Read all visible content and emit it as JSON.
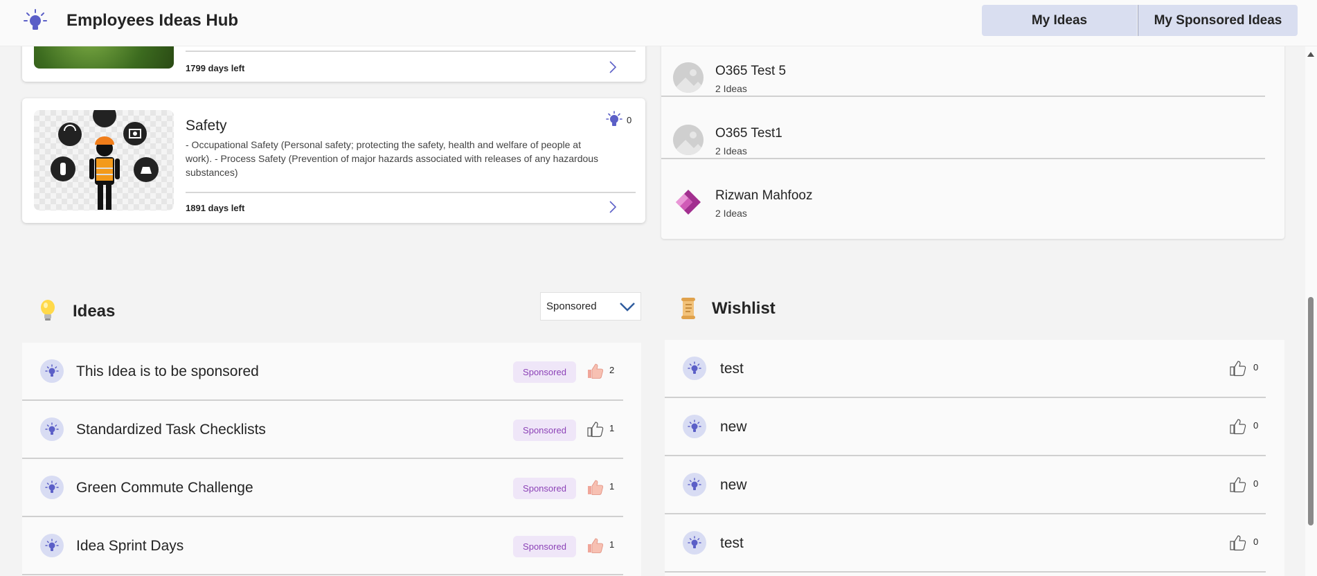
{
  "header": {
    "title": "Employees Ideas Hub",
    "nav": [
      "My Ideas",
      "My Sponsored Ideas"
    ]
  },
  "challenges": [
    {
      "days_left": "1799 days left"
    },
    {
      "title": "Safety",
      "description": "- Occupational Safety (Personal safety; protecting the safety, health and welfare of people at work). - Process Safety (Prevention of major hazards associated with releases of any hazardous substances)",
      "idea_count": "0",
      "days_left": "1891 days left"
    }
  ],
  "sponsors": [
    {
      "name": "O365 Test 5",
      "ideas": "2 Ideas",
      "avatar": "placeholder-image-icon"
    },
    {
      "name": "O365 Test1",
      "ideas": "2 Ideas",
      "avatar": "placeholder-image-icon"
    },
    {
      "name": "Rizwan Mahfooz",
      "ideas": "2 Ideas",
      "avatar": "power-apps-logo-icon"
    }
  ],
  "ideas_section": {
    "title": "Ideas",
    "filter": "Sponsored",
    "items": [
      {
        "title": "This Idea is to be sponsored",
        "badge": "Sponsored",
        "likes": "2",
        "liked": true
      },
      {
        "title": "Standardized Task Checklists",
        "badge": "Sponsored",
        "likes": "1",
        "liked": false
      },
      {
        "title": "Green Commute Challenge",
        "badge": "Sponsored",
        "likes": "1",
        "liked": true
      },
      {
        "title": "Idea Sprint Days",
        "badge": "Sponsored",
        "likes": "1",
        "liked": true
      }
    ]
  },
  "wishlist_section": {
    "title": "Wishlist",
    "items": [
      {
        "title": "test",
        "likes": "0"
      },
      {
        "title": "new",
        "likes": "0"
      },
      {
        "title": "new",
        "likes": "0"
      },
      {
        "title": "test",
        "likes": "0"
      }
    ]
  },
  "colors": {
    "accent": "#5b5fc7",
    "nav_button_bg": "#d9def0",
    "badge_bg": "#efe6f8",
    "badge_text": "#8c42b7"
  }
}
